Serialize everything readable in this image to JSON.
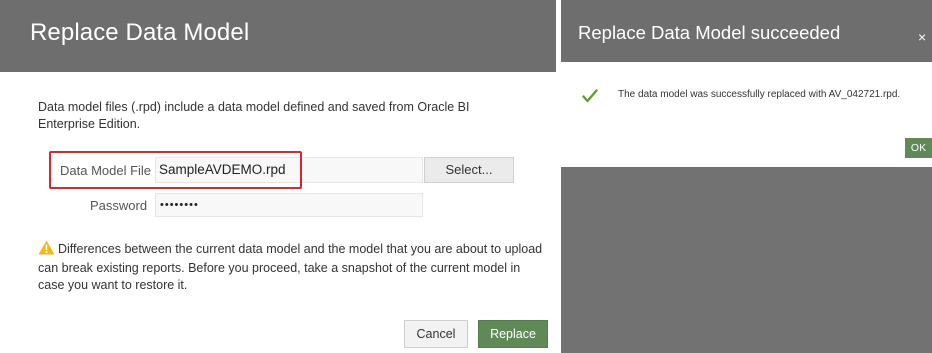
{
  "replace_dialog": {
    "title": "Replace Data Model",
    "description": "Data model files (.rpd) include a data model defined and saved from Oracle BI Enterprise Edition.",
    "file_label": "Data Model File",
    "file_value": "SampleAVDEMO.rpd",
    "select_label": "Select...",
    "password_label": "Password",
    "password_value": "••••••••",
    "warning_text": "Differences between the current data model and the model that you are about to upload can break existing reports. Before you proceed, take a snapshot of the current model in case you want to restore it.",
    "cancel_label": "Cancel",
    "replace_label": "Replace"
  },
  "success_dialog": {
    "title": "Replace Data Model succeeded",
    "close_label": "×",
    "message": "The data model was successfully replaced with AV_042721.rpd.",
    "ok_label": "OK"
  },
  "icons": {
    "warning": "warning-icon",
    "check": "check-icon",
    "close": "close-icon"
  },
  "colors": {
    "header_bg": "#6e6e6e",
    "accent_green": "#5f8a58",
    "highlight_red": "#d8282f",
    "warning_yellow": "#f1b81b",
    "check_green": "#5aa02c"
  }
}
